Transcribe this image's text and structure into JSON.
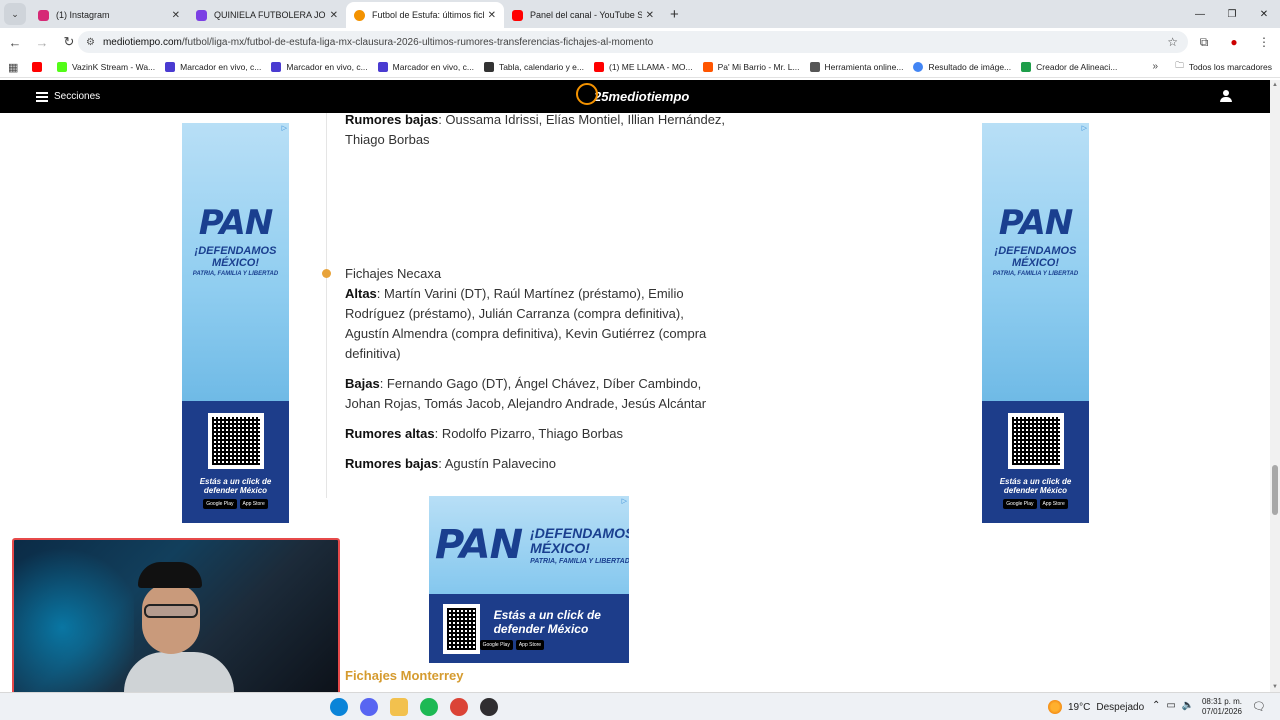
{
  "browser": {
    "tabs": [
      {
        "label": "(1) Instagram",
        "color": "#d62976",
        "active": false
      },
      {
        "label": "QUINIELA FUTBOLERA JORNADA",
        "color": "#7b3fe4",
        "active": false
      },
      {
        "label": "Futbol de Estufa: últimos fichajes",
        "color": "#f39200",
        "active": true
      },
      {
        "label": "Panel del canal - YouTube Studio",
        "color": "#ff0000",
        "active": false
      }
    ],
    "url_host": "mediotiempo.com",
    "url_path": "/futbol/liga-mx/futbol-de-estufa-liga-mx-clausura-2026-ultimos-rumores-transferencias-fichajes-al-momento",
    "bookmarks": [
      {
        "label": "",
        "color": "#ff0000"
      },
      {
        "label": "VazinK Stream - Wa...",
        "color": "#53fc18"
      },
      {
        "label": "Marcador en vivo, c...",
        "color": "#4a3bd1"
      },
      {
        "label": "Marcador en vivo, c...",
        "color": "#4a3bd1"
      },
      {
        "label": "Marcador en vivo, c...",
        "color": "#4a3bd1"
      },
      {
        "label": "Tabla, calendario y e...",
        "color": "#333333"
      },
      {
        "label": "(1) ME LLAMA - MO...",
        "color": "#ff0000"
      },
      {
        "label": "Pa' Mi Barrio - Mr. L...",
        "color": "#ff5500"
      },
      {
        "label": "Herramienta online...",
        "color": "#555555"
      },
      {
        "label": "Resultado de imáge...",
        "color": "#4285f4"
      },
      {
        "label": "Creador de Alineaci...",
        "color": "#1e9e4a"
      }
    ],
    "bookmarks_folder": "Todos los marcadores"
  },
  "site": {
    "menu_label": "Secciones",
    "logo_text": "25mediotiempo"
  },
  "article": {
    "prev_rumores_bajas_label": "Rumores bajas",
    "prev_rumores_bajas_text": ": Oussama Idrissi, Elías Montiel, Illian Hernández, Thiago Borbas",
    "team_title": "Fichajes Necaxa",
    "altas_label": "Altas",
    "altas_text": ": Martín Varini (DT), Raúl Martínez (préstamo), Emilio Rodríguez (préstamo), Julián Carranza (compra definitiva), Agustín Almendra (compra definitiva), Kevin Gutiérrez (compra definitiva)",
    "bajas_label": "Bajas",
    "bajas_text": ": Fernando Gago (DT), Ángel Chávez, Díber Cambindo, Johan Rojas, Tomás Jacob, Alejandro Andrade, Jesús Alcántar",
    "rumores_altas_label": "Rumores altas",
    "rumores_altas_text": ": Rodolfo Pizarro, Thiago Borbas",
    "rumores_bajas_label": "Rumores bajas",
    "rumores_bajas_text": ": Agustín Palavecino",
    "next_team_title": "Fichajes Monterrey"
  },
  "ads": {
    "brand": "PAN",
    "slogan": "¡DEFENDAMOS MÉXICO!",
    "sub": "PATRIA, FAMILIA Y LIBERTAD",
    "cta": "Estás a un click de defender México",
    "store_google": "Google Play",
    "store_apple": "App Store",
    "choice_marker": "▷"
  },
  "taskbar": {
    "temperature": "19°C",
    "weather": "Despejado",
    "time": "08:31 p. m.",
    "date": "07/01/2026"
  }
}
